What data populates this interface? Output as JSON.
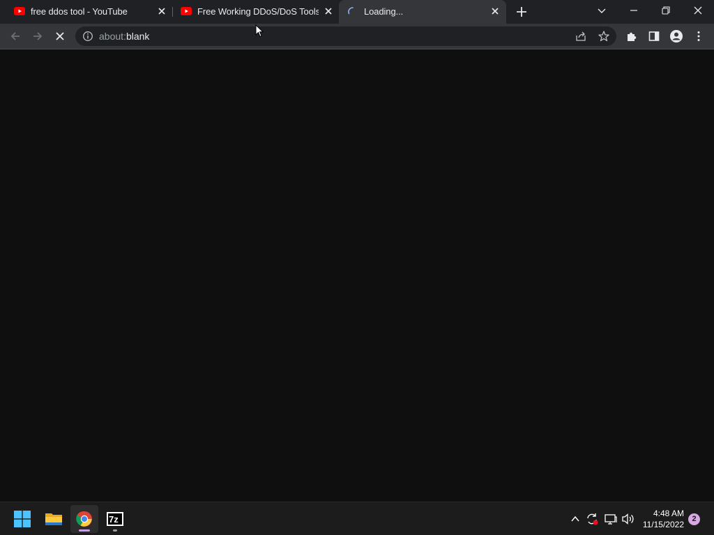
{
  "tabs": [
    {
      "title": "free ddos tool - YouTube",
      "favicon": "youtube-icon",
      "state": "normal"
    },
    {
      "title": "Free Working DDoS/DoS Tools W",
      "favicon": "youtube-icon",
      "state": "normal"
    },
    {
      "title": "Loading...",
      "favicon": "loading-spinner-icon",
      "state": "active-loading"
    }
  ],
  "omnibox": {
    "scheme": "about:",
    "host": "blank"
  },
  "taskbar": {
    "apps": [
      "windows-start",
      "file-explorer",
      "chrome",
      "7-zip"
    ],
    "clock_time": "4:48 AM",
    "clock_date": "11/15/2022",
    "notification_count": "2"
  },
  "colors": {
    "tabstrip": "#202124",
    "toolbar": "#35363a",
    "page": "#0f0f10",
    "taskbar": "#1c1c1c",
    "youtube_red": "#ff0000",
    "notification_badge": "#d7a9e3"
  }
}
